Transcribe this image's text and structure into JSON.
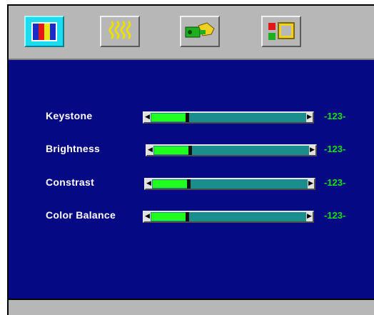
{
  "tabs": [
    {
      "icon": "color-bars-icon",
      "active": true
    },
    {
      "icon": "wavy-lines-icon",
      "active": false
    },
    {
      "icon": "projector-hand-icon",
      "active": false
    },
    {
      "icon": "input-source-icon",
      "active": false
    }
  ],
  "settings": [
    {
      "label": "Keystone",
      "value_text": "-123-",
      "level": 0.22
    },
    {
      "label": "Brightness",
      "value_text": "-123-",
      "level": 0.22
    },
    {
      "label": "Constrast",
      "value_text": "-123-",
      "level": 0.22
    },
    {
      "label": "Color Balance",
      "value_text": "-123-",
      "level": 0.22
    }
  ],
  "colors": {
    "panel": "#050a84",
    "frame": "#b7b7b7",
    "active_tab": "#1edcef",
    "slider_track": "#1a8d8d",
    "slider_fill": "#20ff20",
    "value_text": "#13e30d"
  }
}
